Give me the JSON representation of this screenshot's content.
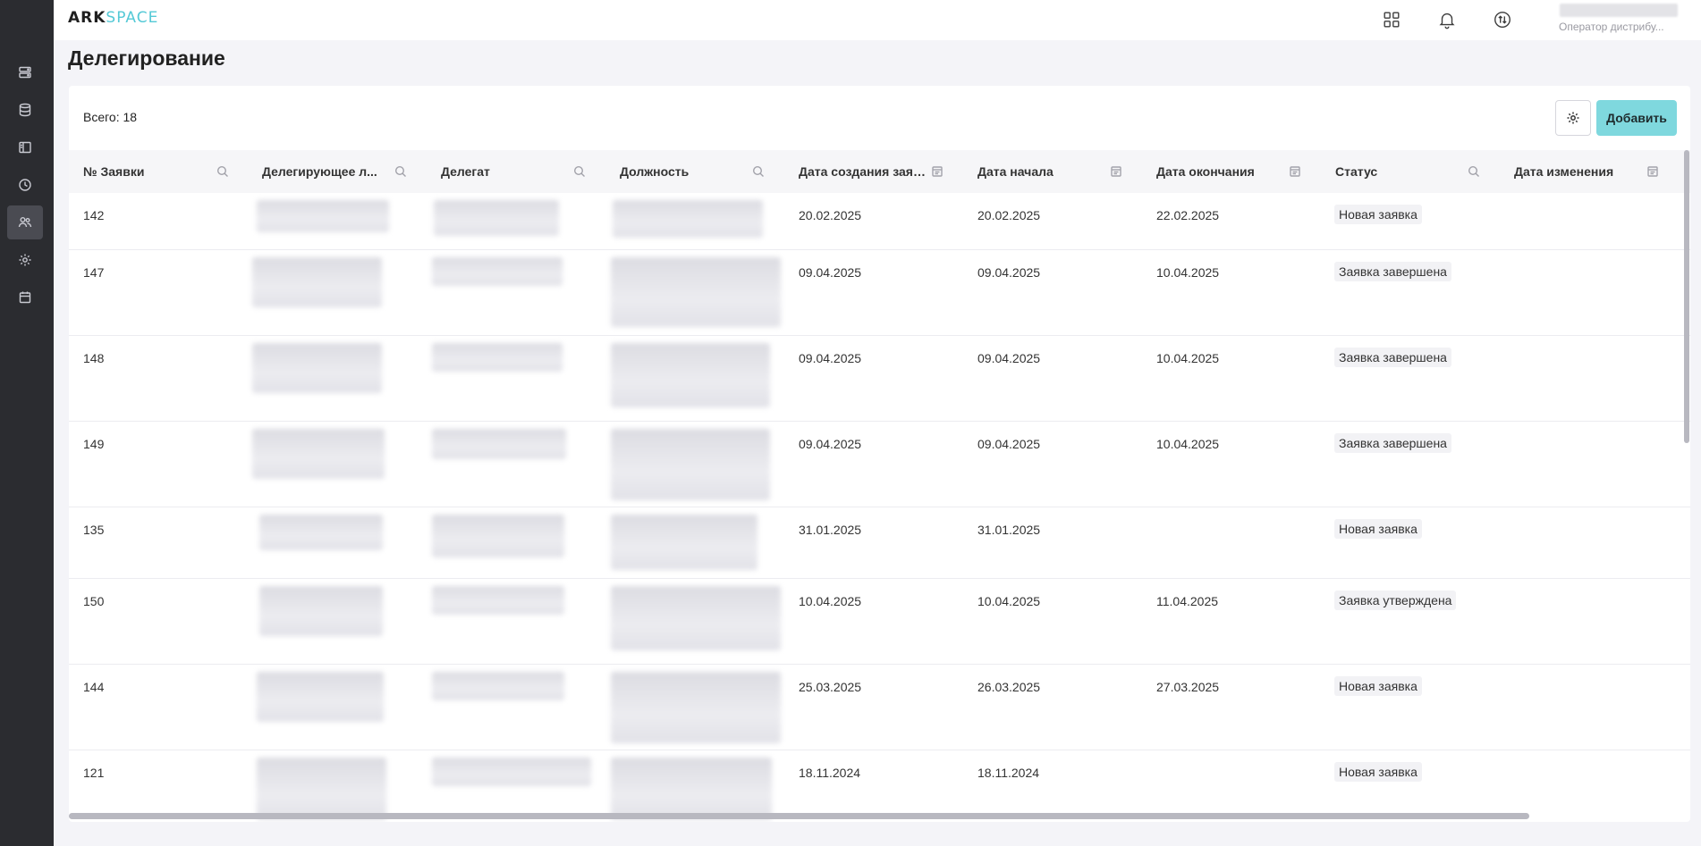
{
  "app": {
    "logo_part1": "ARK",
    "logo_part2": "SPACE"
  },
  "header": {
    "icons": [
      "apps-grid-icon",
      "bell-icon",
      "swap-arrows-icon",
      "chevron-down-icon"
    ],
    "user_role": "Оператор дистрибу..."
  },
  "sidebar": {
    "items": [
      {
        "icon": "server-icon"
      },
      {
        "icon": "database-icon"
      },
      {
        "icon": "panel-icon"
      },
      {
        "icon": "clock-icon"
      },
      {
        "icon": "users-icon",
        "active": true
      },
      {
        "icon": "gear-icon"
      },
      {
        "icon": "calendar-icon"
      }
    ]
  },
  "page": {
    "title": "Делегирование",
    "total_label": "Всего: 18",
    "add_label": "Добавить"
  },
  "table": {
    "columns": [
      {
        "label": "№ Заявки",
        "filter": "search-icon"
      },
      {
        "label": "Делегирующее л...",
        "filter": "search-icon"
      },
      {
        "label": "Делегат",
        "filter": "search-icon"
      },
      {
        "label": "Должность",
        "filter": "search-icon"
      },
      {
        "label": "Дата создания заяв...",
        "filter": "calendar-filter-icon"
      },
      {
        "label": "Дата начала",
        "filter": "calendar-filter-icon"
      },
      {
        "label": "Дата окончания",
        "filter": "calendar-filter-icon"
      },
      {
        "label": "Статус",
        "filter": "search-icon"
      },
      {
        "label": "Дата изменения",
        "filter": "calendar-filter-icon"
      }
    ],
    "rows": [
      {
        "id": "142",
        "created": "20.02.2025",
        "start": "20.02.2025",
        "end": "22.02.2025",
        "status": "Новая заявка",
        "modified": ""
      },
      {
        "id": "147",
        "created": "09.04.2025",
        "start": "09.04.2025",
        "end": "10.04.2025",
        "status": "Заявка завершена",
        "modified": ""
      },
      {
        "id": "148",
        "created": "09.04.2025",
        "start": "09.04.2025",
        "end": "10.04.2025",
        "status": "Заявка завершена",
        "modified": ""
      },
      {
        "id": "149",
        "created": "09.04.2025",
        "start": "09.04.2025",
        "end": "10.04.2025",
        "status": "Заявка завершена",
        "modified": ""
      },
      {
        "id": "135",
        "created": "31.01.2025",
        "start": "31.01.2025",
        "end": "",
        "status": "Новая заявка",
        "modified": ""
      },
      {
        "id": "150",
        "created": "10.04.2025",
        "start": "10.04.2025",
        "end": "11.04.2025",
        "status": "Заявка утверждена",
        "modified": ""
      },
      {
        "id": "144",
        "created": "25.03.2025",
        "start": "26.03.2025",
        "end": "27.03.2025",
        "status": "Новая заявка",
        "modified": ""
      },
      {
        "id": "121",
        "created": "18.11.2024",
        "start": "18.11.2024",
        "end": "",
        "status": "Новая заявка",
        "modified": ""
      }
    ]
  },
  "colors": {
    "sidebar_bg": "#2b2c30",
    "accent": "#7fd8de",
    "logo_accent": "#54c9d6"
  }
}
